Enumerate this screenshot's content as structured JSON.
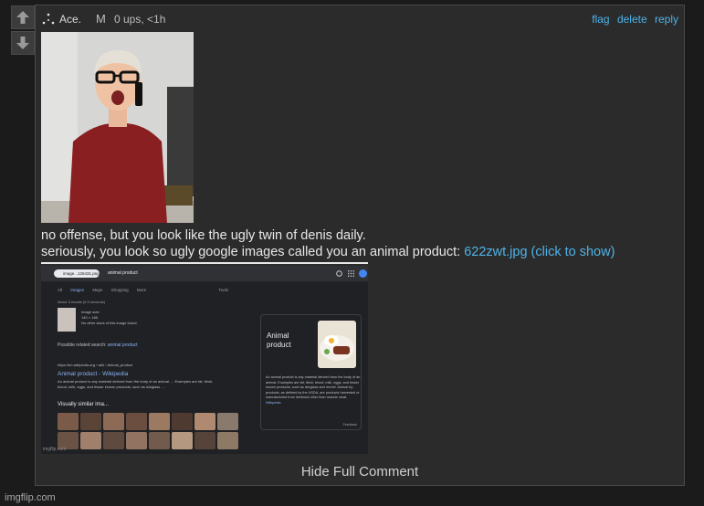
{
  "vote": {
    "up_icon": "arrow-up-icon",
    "down_icon": "arrow-down-icon"
  },
  "comment": {
    "username": "Ace.",
    "badge": "M",
    "meta": "0 ups, <1h",
    "actions": {
      "flag": "flag",
      "delete": "delete",
      "reply": "reply"
    },
    "line1": "no offense, but you look like the ugly twin of denis daily.",
    "line2": "seriously, you look so ugly google images called you an animal product:",
    "attachment_link": "622zwt.jpg (click to show)",
    "hide_label": "Hide Full Comment"
  },
  "embedded_search": {
    "chip": "image...126431.png",
    "query": "animal product",
    "tabs": [
      "All",
      "Images",
      "Maps",
      "Shopping",
      "More",
      "Tools"
    ],
    "results_count": "About 3 results (0.9 seconds)",
    "image_info": [
      "Image size:",
      "140 × 166",
      "No other sizes of this image found."
    ],
    "related_label": "Possible related search:",
    "related_term": "animal product",
    "result_url": "https://en.wikipedia.org › wiki › Animal_product",
    "result_title": "Animal product - Wikipedia",
    "result_desc": "An animal product is any material derived from the body of an animal. ... Examples are fat, flesh, blood, milk, eggs, and lesser known products, such as isinglass ...",
    "similar_title": "Visually similar ima...",
    "panel_title": "Animal product",
    "panel_desc": "An animal product is any material derived from the body of an animal. Examples are fat, flesh, blood, milk, eggs, and lesser known products, such as isinglass and rennet. Animal by-products, as defined by the USDA, are products harvested or manufactured from livestock other than muscle meat.",
    "panel_source": "Wikipedia",
    "feedback": "Feedback",
    "watermark": "imgflip.com"
  },
  "footer": {
    "watermark": "imgflip.com"
  },
  "colors": {
    "link": "#4fb3e8",
    "panel_bg": "#2b2b2b",
    "page_bg": "#1b1b1b"
  }
}
